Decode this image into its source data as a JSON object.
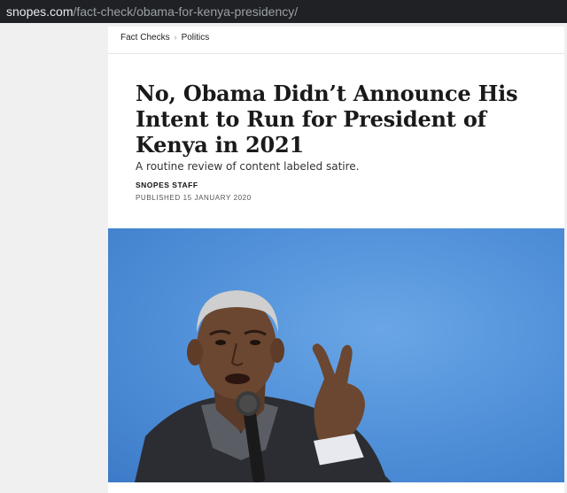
{
  "browser": {
    "url_host": "snopes.com",
    "url_path": "/fact-check/obama-for-kenya-presidency/"
  },
  "breadcrumb": {
    "items": [
      "Fact Checks",
      "Politics"
    ],
    "separator": "›"
  },
  "article": {
    "headline": "No, Obama Didn’t Announce His Intent to Run for President of Kenya in 2021",
    "subtitle": "A routine review of content labeled satire.",
    "author": "SNOPES STAFF",
    "published": "PUBLISHED 15 JANUARY 2020"
  },
  "hero_image": {
    "subject": "man-speaking-into-microphone-with-raised-hand",
    "background_color": "#4f8fd8"
  },
  "colors": {
    "url_bar_bg": "#202124",
    "page_bg": "#f0f0f0",
    "article_bg": "#ffffff",
    "headline": "#1a1a1a"
  }
}
